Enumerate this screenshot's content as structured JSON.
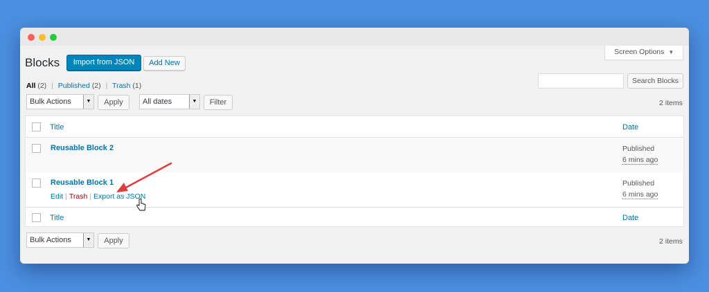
{
  "screen_options": {
    "label": "Screen Options",
    "caret": "▼"
  },
  "header": {
    "title": "Blocks",
    "import_label": "Import from JSON",
    "add_new_label": "Add New"
  },
  "filters": {
    "all_label": "All",
    "all_count": "(2)",
    "published_label": "Published",
    "published_count": "(2)",
    "trash_label": "Trash",
    "trash_count": "(1)",
    "separator": "|"
  },
  "search": {
    "button_label": "Search Blocks",
    "value": ""
  },
  "top_nav": {
    "bulk_actions": "Bulk Actions",
    "apply_label": "Apply",
    "dates_value": "All dates",
    "filter_label": "Filter",
    "items_count": "2 items"
  },
  "table": {
    "columns": {
      "title": "Title",
      "date": "Date"
    },
    "rows": [
      {
        "title": "Reusable Block 2",
        "status": "Published",
        "date": "6 mins ago"
      },
      {
        "title": "Reusable Block 1",
        "status": "Published",
        "date": "6 mins ago",
        "actions": {
          "edit": "Edit",
          "trash": "Trash",
          "export": "Export as JSON"
        }
      }
    ]
  },
  "bottom_nav": {
    "bulk_actions": "Bulk Actions",
    "apply_label": "Apply",
    "items_count": "2 items"
  },
  "annotation": {
    "arrow_color": "#e03c3c"
  },
  "select_arrow_glyph": "▼"
}
